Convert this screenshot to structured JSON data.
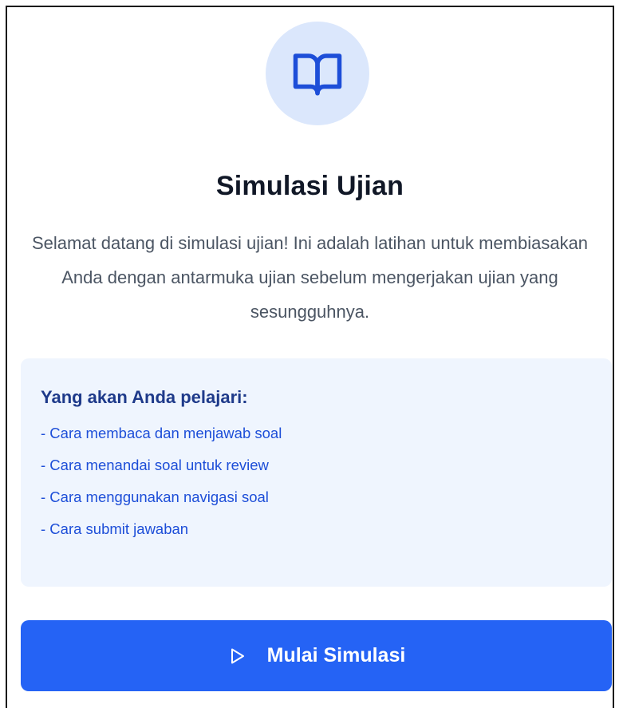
{
  "header": {
    "icon": "book-open-icon",
    "title": "Simulasi Ujian",
    "description": "Selamat datang di simulasi ujian! Ini adalah latihan untuk membiasakan Anda dengan antarmuka ujian sebelum mengerjakan ujian yang sesungguhnya."
  },
  "info": {
    "title": "Yang akan Anda pelajari:",
    "items": [
      "- Cara membaca dan menjawab soal",
      "- Cara menandai soal untuk review",
      "- Cara menggunakan navigasi soal",
      "- Cara submit jawaban"
    ]
  },
  "action": {
    "icon": "play-icon",
    "label": "Mulai Simulasi"
  },
  "colors": {
    "accent": "#2563f5",
    "icon_bg": "#dbe7fc",
    "info_bg": "#eff5fe",
    "info_title": "#1e3a8a",
    "info_text": "#1d4ed8"
  }
}
